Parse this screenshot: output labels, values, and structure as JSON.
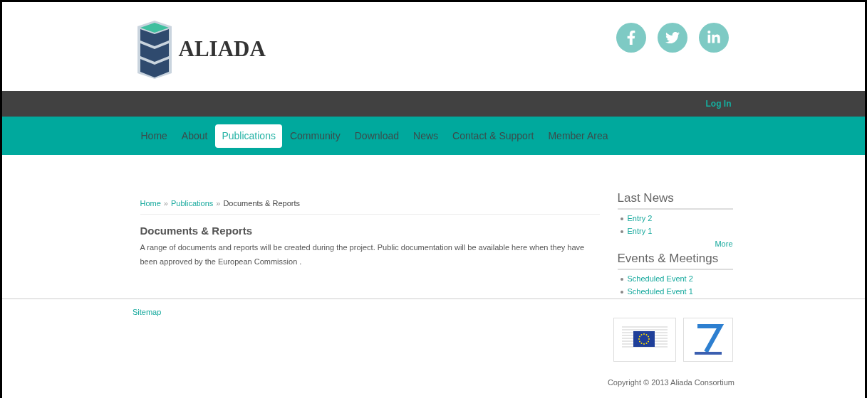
{
  "logo": {
    "text": "ALIADA"
  },
  "top_bar": {
    "login": "Log In"
  },
  "nav": [
    {
      "label": "Home",
      "selected": false
    },
    {
      "label": "About",
      "selected": false
    },
    {
      "label": "Publications",
      "selected": true
    },
    {
      "label": "Community",
      "selected": false
    },
    {
      "label": "Download",
      "selected": false
    },
    {
      "label": "News",
      "selected": false
    },
    {
      "label": "Contact & Support",
      "selected": false
    },
    {
      "label": "Member Area",
      "selected": false
    }
  ],
  "breadcrumb": {
    "links": [
      "Home",
      "Publications"
    ],
    "current": "Documents & Reports",
    "separator": "»"
  },
  "article": {
    "title": "Documents & Reports",
    "body": "A range of documents and reports will be created during the project. Public documentation will be available here when they have been approved by the European Commission ."
  },
  "sidebar": [
    {
      "title": "Last News",
      "items": [
        "Entry 2",
        "Entry 1"
      ],
      "more": "More"
    },
    {
      "title": "Events & Meetings",
      "items": [
        "Scheduled Event 2",
        "Scheduled Event 1"
      ]
    }
  ],
  "footer": {
    "sitemap": "Sitemap",
    "copyright": "Copyright © 2013 Aliada Consortium"
  }
}
